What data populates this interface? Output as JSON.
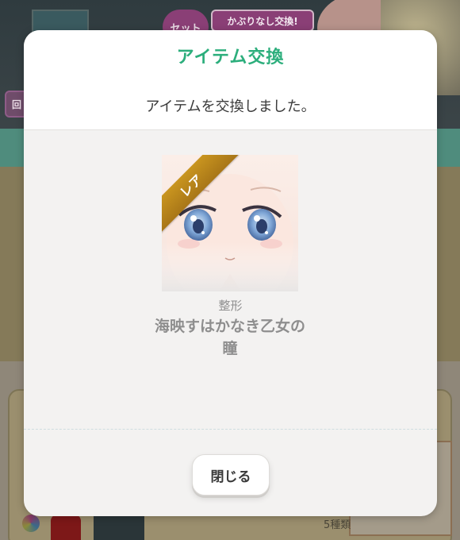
{
  "background": {
    "set_badge": "セット",
    "swap_banner": "かぶりなし交換!",
    "side_badge": "回",
    "exclamation": "!",
    "variety_count": "5種類"
  },
  "modal": {
    "title": "アイテム交換",
    "message": "アイテムを交換しました。",
    "item": {
      "rarity": "レア",
      "category": "整形",
      "name": "海映すはかなき乙女の瞳"
    },
    "close_label": "閉じる"
  },
  "colors": {
    "title_green": "#2cae7c",
    "rare_gold": "#b8841c",
    "text_gray": "#8e8e8e"
  }
}
